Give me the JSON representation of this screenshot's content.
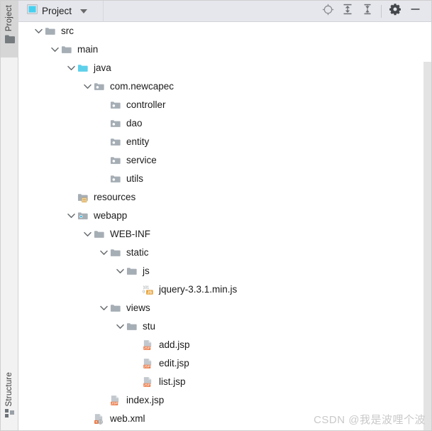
{
  "window": {
    "tool_window_stripes": [
      {
        "id": "project",
        "label": "Project",
        "icon": "folder-icon",
        "selected": true
      },
      {
        "id": "structure",
        "label": "Structure",
        "icon": "structure-icon",
        "selected": false
      }
    ]
  },
  "header": {
    "tab_label": "Project",
    "tab_icon": "project-view-icon",
    "dropdown_icon": "chevron-down-icon",
    "actions": [
      {
        "id": "locate",
        "icon": "locate-target-icon",
        "title": "Select Opened File"
      },
      {
        "id": "expand-all",
        "icon": "expand-all-icon",
        "title": "Expand All"
      },
      {
        "id": "collapse-all",
        "icon": "collapse-all-icon",
        "title": "Collapse All"
      },
      {
        "id": "settings",
        "icon": "gear-icon",
        "title": "Settings"
      },
      {
        "id": "hide",
        "icon": "minimize-icon",
        "title": "Hide"
      }
    ]
  },
  "tree": {
    "nodes": [
      {
        "label": "src",
        "depth": 1,
        "twisty": "expanded",
        "icon": "folder-gray-icon"
      },
      {
        "label": "main",
        "depth": 2,
        "twisty": "expanded",
        "icon": "folder-gray-icon"
      },
      {
        "label": "java",
        "depth": 3,
        "twisty": "expanded",
        "icon": "folder-source-root-icon"
      },
      {
        "label": "com.newcapec",
        "depth": 4,
        "twisty": "expanded",
        "icon": "package-icon"
      },
      {
        "label": "controller",
        "depth": 5,
        "twisty": "none",
        "icon": "package-icon"
      },
      {
        "label": "dao",
        "depth": 5,
        "twisty": "none",
        "icon": "package-icon"
      },
      {
        "label": "entity",
        "depth": 5,
        "twisty": "none",
        "icon": "package-icon"
      },
      {
        "label": "service",
        "depth": 5,
        "twisty": "none",
        "icon": "package-icon"
      },
      {
        "label": "utils",
        "depth": 5,
        "twisty": "none",
        "icon": "package-icon"
      },
      {
        "label": "resources",
        "depth": 3,
        "twisty": "none",
        "icon": "folder-resources-icon"
      },
      {
        "label": "webapp",
        "depth": 3,
        "twisty": "expanded",
        "icon": "folder-webapp-icon"
      },
      {
        "label": "WEB-INF",
        "depth": 4,
        "twisty": "expanded",
        "icon": "folder-gray-icon"
      },
      {
        "label": "static",
        "depth": 5,
        "twisty": "expanded",
        "icon": "folder-gray-icon"
      },
      {
        "label": "js",
        "depth": 6,
        "twisty": "expanded",
        "icon": "folder-gray-icon"
      },
      {
        "label": "jquery-3.3.1.min.js",
        "depth": 7,
        "twisty": "none",
        "icon": "js-minified-file-icon"
      },
      {
        "label": "views",
        "depth": 5,
        "twisty": "expanded",
        "icon": "folder-gray-icon"
      },
      {
        "label": "stu",
        "depth": 6,
        "twisty": "expanded",
        "icon": "folder-gray-icon"
      },
      {
        "label": "add.jsp",
        "depth": 7,
        "twisty": "none",
        "icon": "jsp-file-icon"
      },
      {
        "label": "edit.jsp",
        "depth": 7,
        "twisty": "none",
        "icon": "jsp-file-icon"
      },
      {
        "label": "list.jsp",
        "depth": 7,
        "twisty": "none",
        "icon": "jsp-file-icon"
      },
      {
        "label": "index.jsp",
        "depth": 5,
        "twisty": "none",
        "icon": "jsp-file-icon"
      },
      {
        "label": "web.xml",
        "depth": 4,
        "twisty": "none",
        "icon": "xml-descriptor-file-icon"
      }
    ]
  },
  "watermark": {
    "text": "CSDN @我是波哩个波"
  },
  "colors": {
    "header_bg": "#e6e7ec",
    "stripe_bg": "#f2f2f2",
    "stripe_selected_bg": "#d6d6d6",
    "tree_bg": "#ffffff",
    "text": "#1b1b1b",
    "folder_gray": "#a6aeb5",
    "source_root_cyan": "#5ed0ea",
    "badge_orange": "#e8703a",
    "accent_cyan": "#24b6e0",
    "watermark": "#c9c9c9"
  }
}
